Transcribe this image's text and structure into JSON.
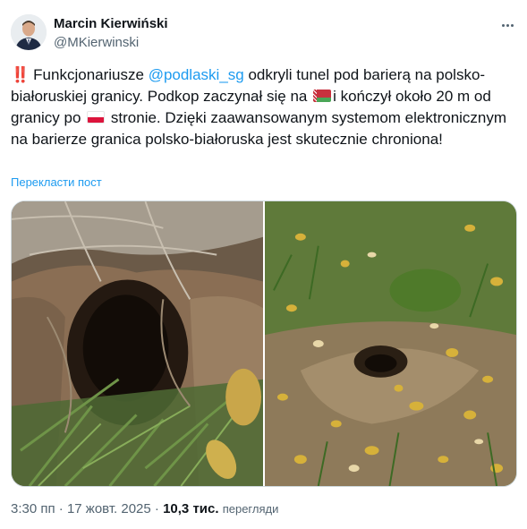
{
  "author": {
    "name": "Marcin Kierwiński",
    "handle": "@MKierwinski"
  },
  "post": {
    "bang": "‼️",
    "part1": "Funkcjonariusze ",
    "mention": "@podlaski_sg",
    "part2": " odkryli tunel pod barierą na polsko-białoruskiej granicy. Podkop zaczynał się na ",
    "part3": "i kończył około 20 m od granicy po ",
    "part4": " stronie. Dzięki zaawansowanym systemom elektronicznym na barierze granica polsko-białoruska jest skutecznie chroniona!",
    "flag_by_icon": "belarus-flag-icon",
    "flag_pl_icon": "poland-flag-icon"
  },
  "translate_link": "Перекласти пост",
  "meta": {
    "time": "3:30 пп",
    "separator": " · ",
    "date": "17 жовт. 2025",
    "views_count": "10,3 тис.",
    "views_label": "перегляди"
  },
  "colors": {
    "link": "#1d9bf0",
    "secondary_text": "#536471",
    "primary_text": "#0f1419"
  }
}
